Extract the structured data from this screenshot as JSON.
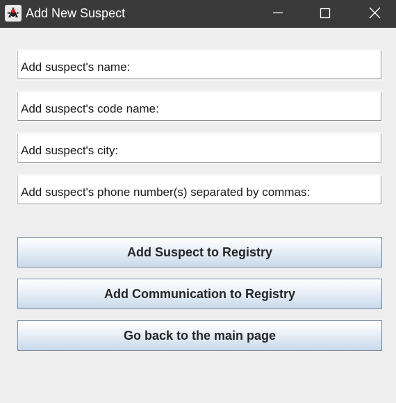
{
  "window": {
    "title": "Add New Suspect",
    "icon": "java-duke-icon",
    "controls": {
      "minimize": "minimize-icon",
      "maximize": "maximize-icon",
      "close": "close-icon"
    }
  },
  "form": {
    "name_label": "Add suspect's name:",
    "codename_label": "Add suspect's code name:",
    "city_label": "Add suspect's city:",
    "phone_label": "Add suspect's phone number(s) separated by commas:"
  },
  "buttons": {
    "add_suspect": "Add Suspect to Registry",
    "add_communication": "Add Communication to Registry",
    "go_back": "Go back to the main page"
  },
  "colors": {
    "titlebar": "#3a3a3a",
    "background": "#eeeeee",
    "field": "#ffffff",
    "button_gradient_top": "#ffffff",
    "button_gradient_bottom": "#c9d9ea",
    "button_border": "#7a8aa0"
  }
}
